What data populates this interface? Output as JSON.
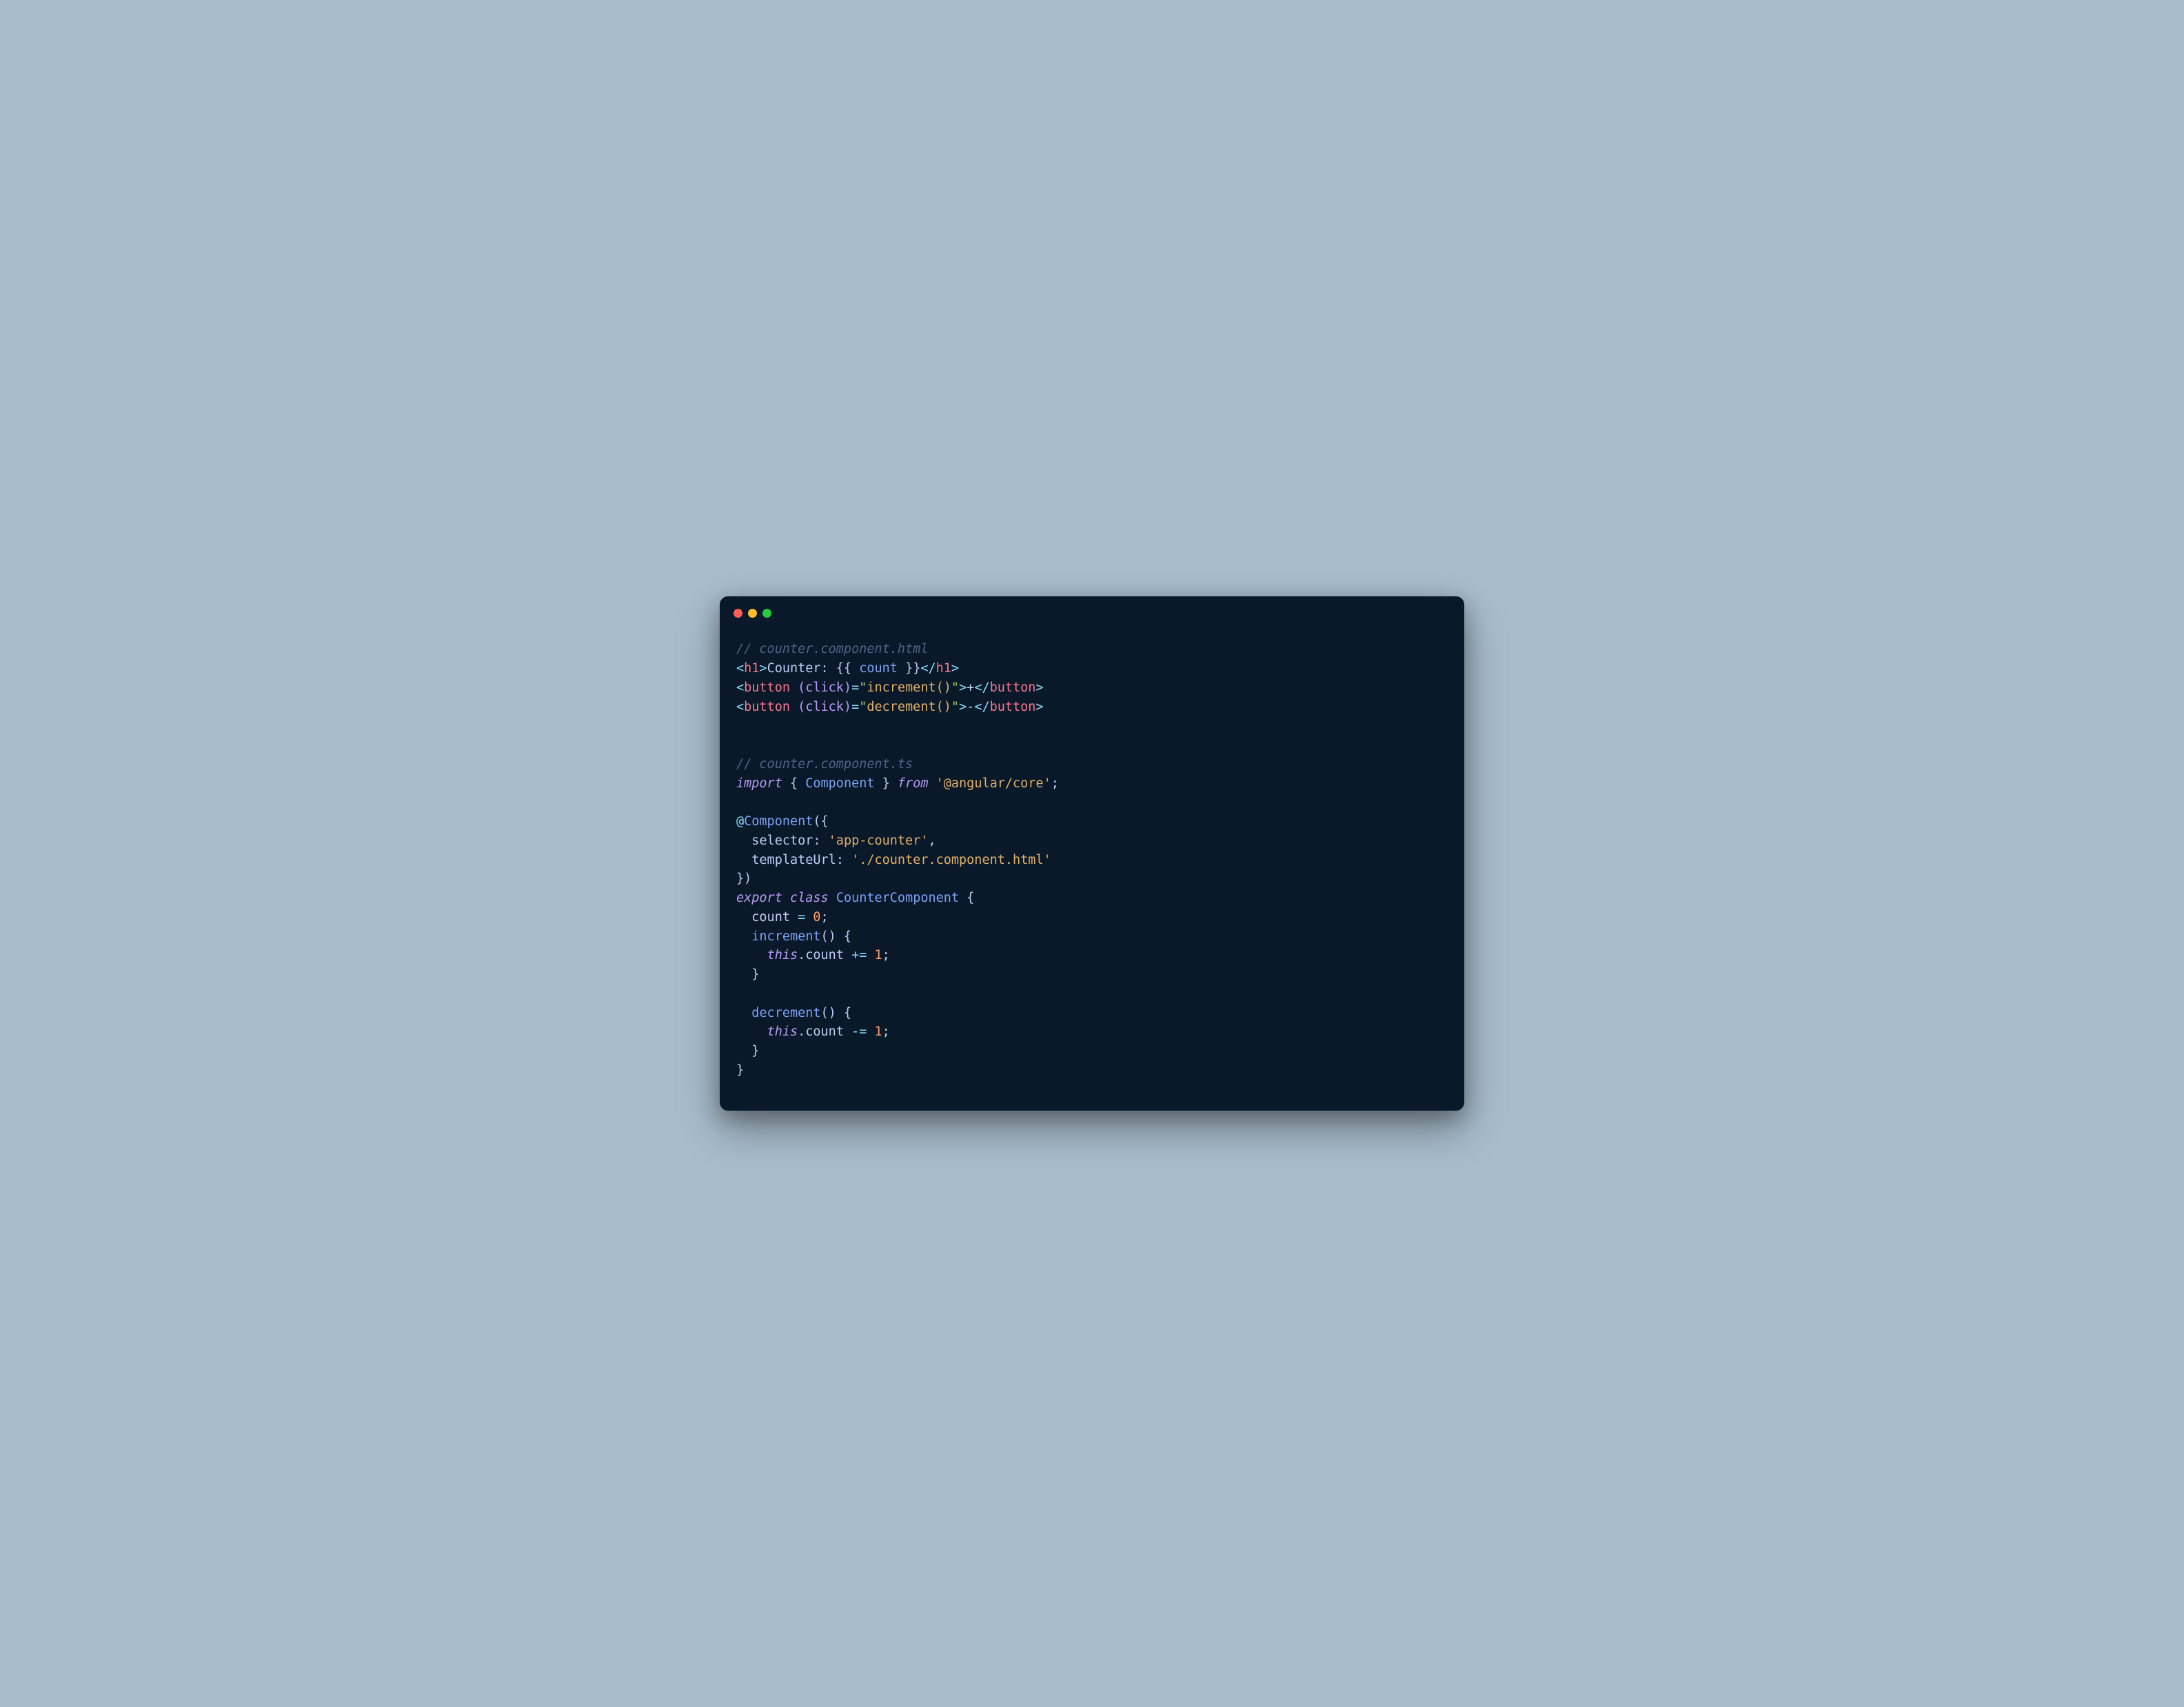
{
  "traffic_lights": {
    "red": "#ff5f56",
    "yellow": "#ffbd2e",
    "green": "#27c93f"
  },
  "code": {
    "c1": "// counter.component.html",
    "l2": {
      "open_lt": "<",
      "h1_open": "h1",
      "gt1": ">",
      "txt": "Counter: ",
      "lbrace": "{{ ",
      "count": "count",
      "rbrace": " }}",
      "close_lt": "</",
      "h1_close": "h1",
      "gt2": ">"
    },
    "l3": {
      "open_lt": "<",
      "btn": "button",
      "sp": " ",
      "attr": "(click)",
      "eq": "=",
      "q1": "\"",
      "val": "increment()",
      "q2": "\"",
      "gt1": ">",
      "txt": "+",
      "close_lt": "</",
      "btn2": "button",
      "gt2": ">"
    },
    "l4": {
      "open_lt": "<",
      "btn": "button",
      "sp": " ",
      "attr": "(click)",
      "eq": "=",
      "q1": "\"",
      "val": "decrement()",
      "q2": "\"",
      "gt1": ">",
      "txt": "-",
      "close_lt": "</",
      "btn2": "button",
      "gt2": ">"
    },
    "c2": "// counter.component.ts",
    "l7": {
      "import": "import",
      "sp1": " ",
      "lbrace": "{ ",
      "comp": "Component",
      "rbrace": " }",
      "sp2": " ",
      "from": "from",
      "sp3": " ",
      "str": "'@angular/core'",
      "semi": ";"
    },
    "l9": {
      "at": "@",
      "comp": "Component",
      "lparen": "(",
      "lbrace": "{"
    },
    "l10": {
      "indent": "  ",
      "key": "selector",
      "colon": ": ",
      "val": "'app-counter'",
      "comma": ","
    },
    "l11": {
      "indent": "  ",
      "key": "templateUrl",
      "colon": ": ",
      "val": "'./counter.component.html'"
    },
    "l12": {
      "rbrace": "}",
      "rparen": ")"
    },
    "l13": {
      "export": "export",
      "sp1": " ",
      "class": "class",
      "sp2": " ",
      "name": "CounterComponent",
      "sp3": " ",
      "lbrace": "{"
    },
    "l14": {
      "indent": "  ",
      "prop": "count",
      "sp": " ",
      "eq": "=",
      "sp2": " ",
      "num": "0",
      "semi": ";"
    },
    "l15": {
      "indent": "  ",
      "fn": "increment",
      "parens": "()",
      "sp": " ",
      "lbrace": "{"
    },
    "l16": {
      "indent": "    ",
      "this": "this",
      "dot": ".",
      "prop": "count",
      "sp": " ",
      "op": "+=",
      "sp2": " ",
      "num": "1",
      "semi": ";"
    },
    "l17": {
      "indent": "  ",
      "rbrace": "}"
    },
    "l19": {
      "indent": "  ",
      "fn": "decrement",
      "parens": "()",
      "sp": " ",
      "lbrace": "{"
    },
    "l20": {
      "indent": "    ",
      "this": "this",
      "dot": ".",
      "prop": "count",
      "sp": " ",
      "op": "-=",
      "sp2": " ",
      "num": "1",
      "semi": ";"
    },
    "l21": {
      "indent": "  ",
      "rbrace": "}"
    },
    "l22": {
      "rbrace": "}"
    }
  }
}
